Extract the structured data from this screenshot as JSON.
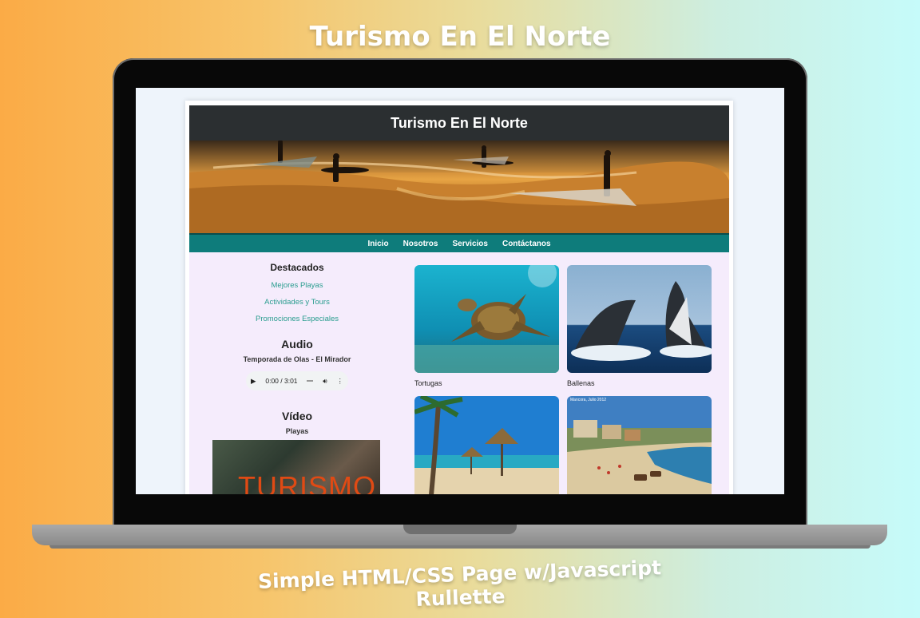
{
  "promo": {
    "title": "Turismo En El Norte",
    "subtitle": "Simple HTML/CSS Page w/Javascript Rullette"
  },
  "site": {
    "header_title": "Turismo En El Norte",
    "nav": [
      "Inicio",
      "Nosotros",
      "Servicios",
      "Contáctanos"
    ],
    "sidebar": {
      "heading": "Destacados",
      "links": [
        "Mejores Playas",
        "Actividades y Tours",
        "Promociones Especiales"
      ]
    },
    "audio": {
      "heading": "Audio",
      "track": "Temporada de Olas - El Mirador",
      "time": "0:00 / 3:01"
    },
    "video": {
      "heading": "Vídeo",
      "title": "Playas",
      "overlay_text": "TURISMO"
    },
    "gallery": [
      {
        "caption": "Tortugas"
      },
      {
        "caption": "Ballenas"
      },
      {
        "caption": ""
      },
      {
        "caption": "",
        "watermark": "Mancora, Julio 2012"
      }
    ]
  },
  "colors": {
    "header_bg": "#2b2f31",
    "nav_bg": "#0e7c7b",
    "link": "#2a9d8f",
    "content_bg": "#f5ecfc"
  }
}
